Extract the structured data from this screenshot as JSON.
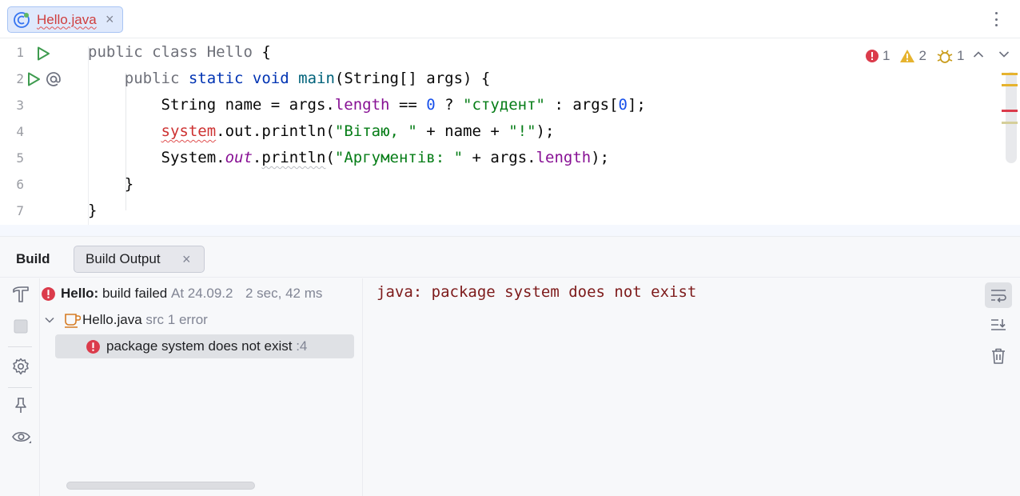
{
  "editor": {
    "tab": {
      "filename": "Hello.java",
      "close_glyph": "×",
      "icon": "java-class-icon"
    },
    "more_icon": "kebab-menu-icon",
    "line_numbers": [
      "1",
      "2",
      "3",
      "4",
      "5",
      "6",
      "7"
    ],
    "inspections": {
      "errors": "1",
      "warnings": "2",
      "weak_warnings": "1"
    },
    "nav": {
      "prev": "⌃",
      "next": "⌄"
    },
    "code": {
      "l1": {
        "t1": "public class Hello ",
        "t2": "{"
      },
      "l2": {
        "indent": "    ",
        "t1": "public ",
        "t2": "static ",
        "t3": "void ",
        "t4": "main",
        "t5": "(String[] args) {"
      },
      "l3": {
        "indent": "        ",
        "t1": "String name = args.",
        "t2": "length",
        "t3": " == ",
        "t4": "0",
        "t5": " ? ",
        "t6": "\"студент\"",
        "t7": " : args[",
        "t8": "0",
        "t9": "];"
      },
      "l4": {
        "indent": "        ",
        "t1": "system",
        "t2": ".out.println(",
        "t3": "\"Вітаю, \"",
        "t4": " + name + ",
        "t5": "\"!\"",
        "t6": ");"
      },
      "l5": {
        "indent": "        ",
        "t1": "System.",
        "t2": "out",
        "t3": ".",
        "t4": "println",
        "t5": "(",
        "t6": "\"Аргументів: \"",
        "t7": " + args.",
        "t8": "length",
        "t9": ");"
      },
      "l6": {
        "indent": "    ",
        "t1": "}"
      },
      "l7": {
        "t1": "}"
      }
    },
    "colors": {
      "error": "#db3b4b",
      "warning": "#e6b32e",
      "keyword": "#0033b3",
      "string": "#067d17"
    }
  },
  "build": {
    "title": "Build",
    "tab_label": "Build Output",
    "tab_close": "×",
    "tree": {
      "root": {
        "name": "Hello:",
        "status": "build failed",
        "time": "At 24.09.2",
        "duration": "2 sec, 42 ms"
      },
      "file": {
        "name": "Hello.java",
        "meta": "src 1 error"
      },
      "error": {
        "message": "package system does not exist",
        "line": ":4"
      }
    },
    "console_line": "java: package system does not exist",
    "strip_icons": [
      "hammer-icon",
      "stop-icon",
      "settings-icon",
      "pin-icon",
      "eye-icon"
    ],
    "action_icons": [
      "soft-wrap-icon",
      "scroll-to-end-icon",
      "trash-icon"
    ]
  }
}
